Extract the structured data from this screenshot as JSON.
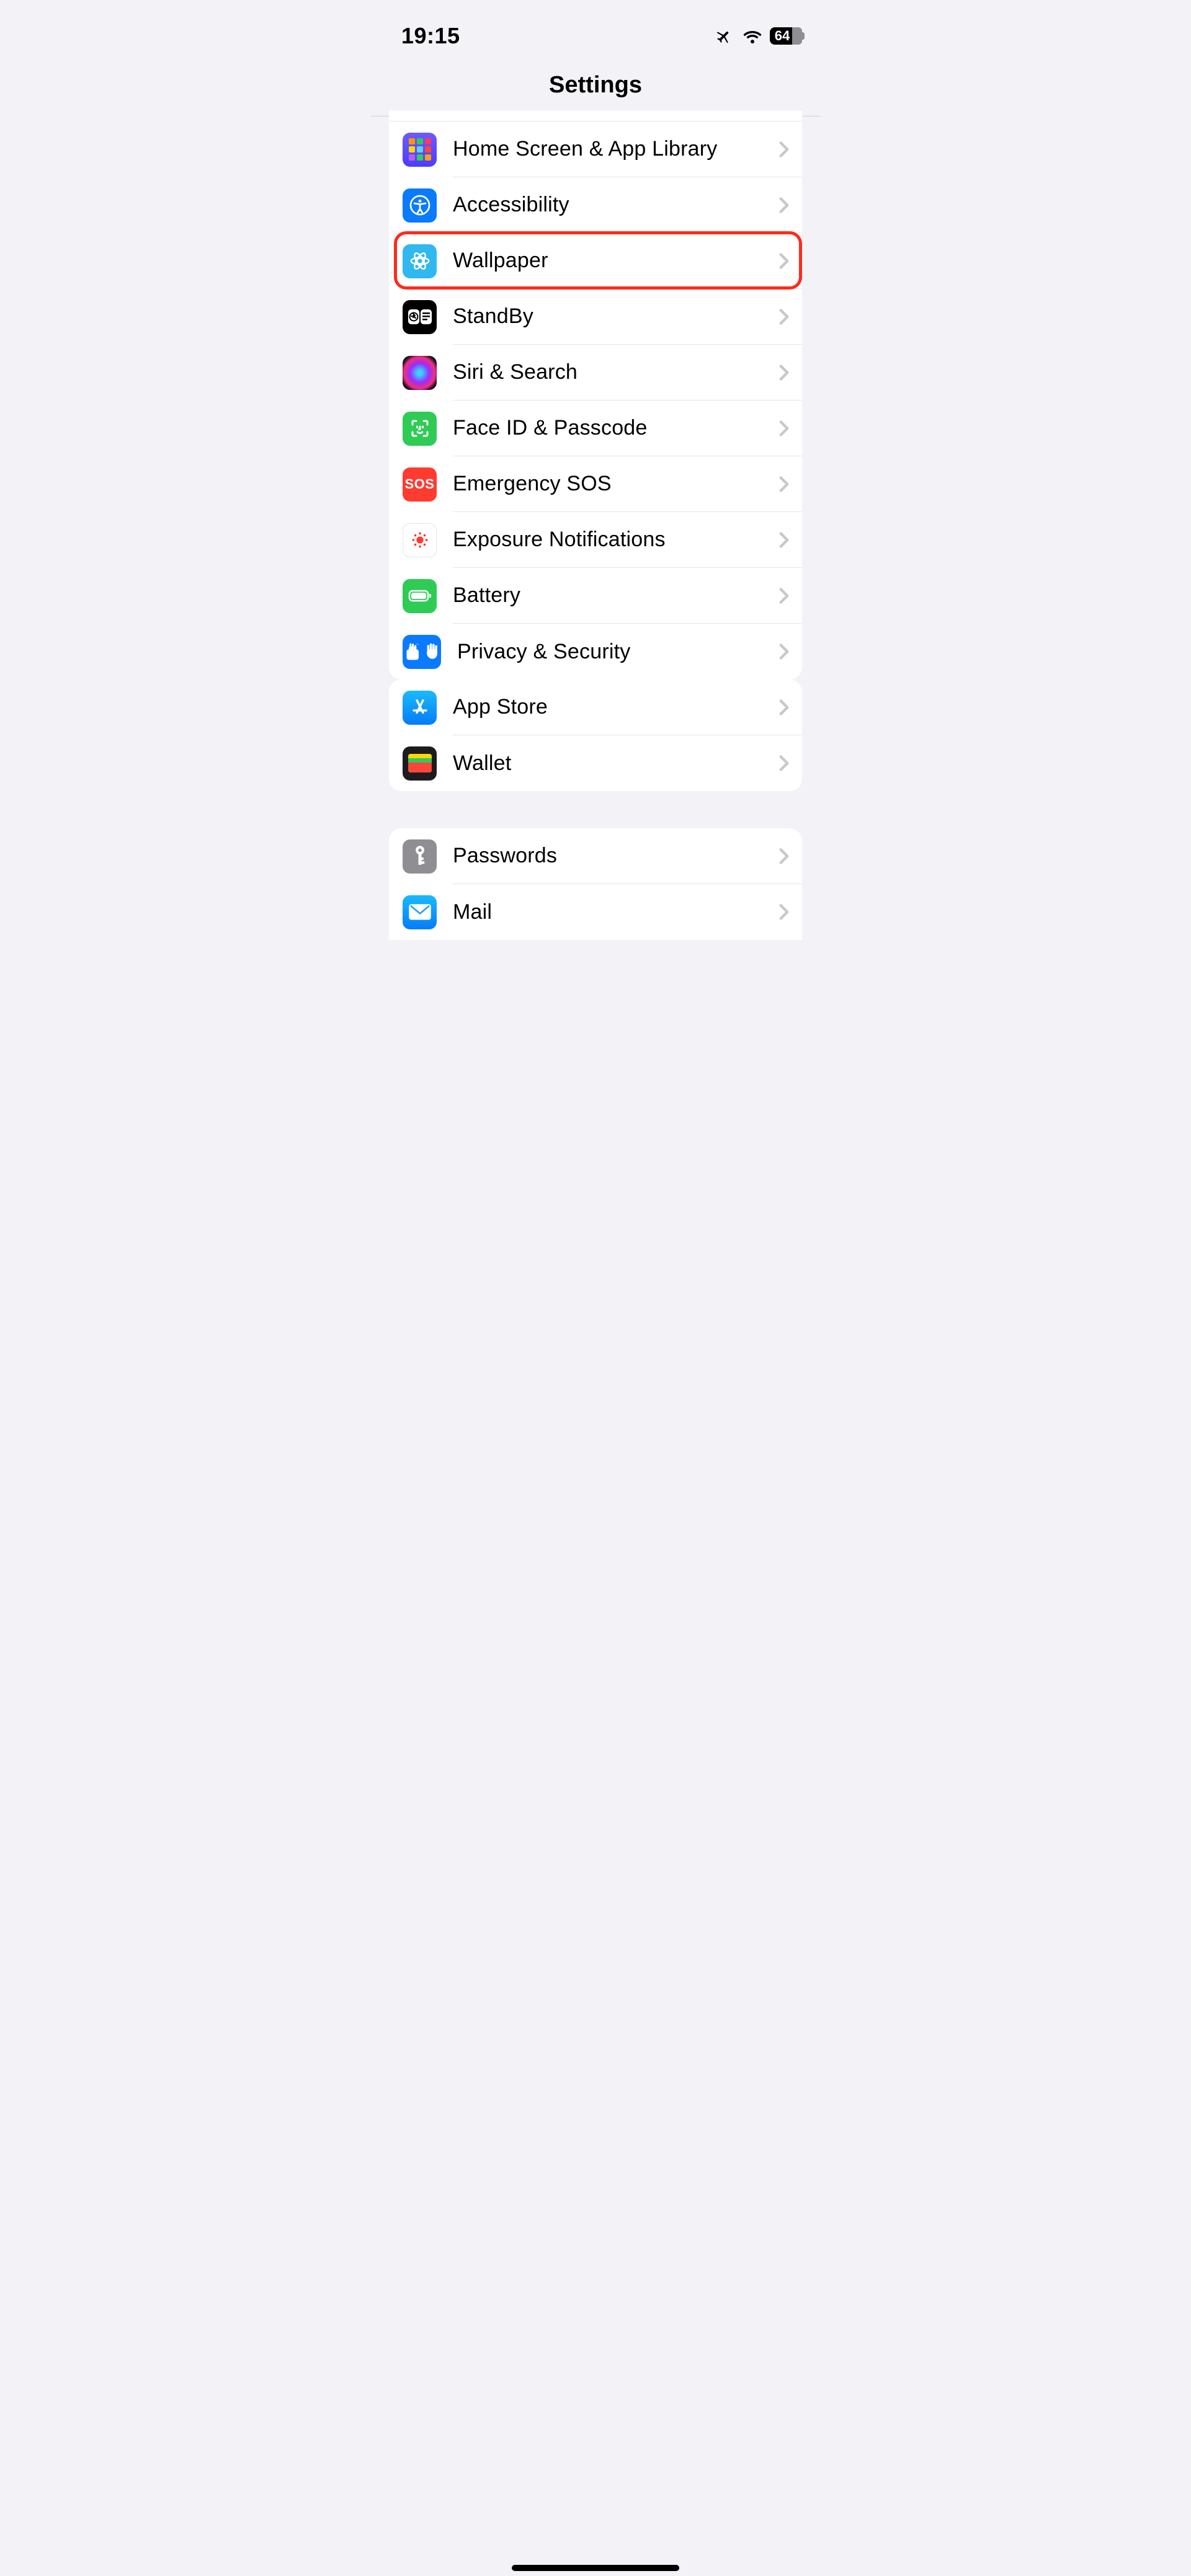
{
  "status": {
    "time": "19:15",
    "battery_percent": "64"
  },
  "header": {
    "title": "Settings"
  },
  "sections": [
    {
      "rows": [
        {
          "label": "Home Screen & App Library"
        },
        {
          "label": "Accessibility"
        },
        {
          "label": "Wallpaper"
        },
        {
          "label": "StandBy"
        },
        {
          "label": "Siri & Search"
        },
        {
          "label": "Face ID & Passcode"
        },
        {
          "label": "Emergency SOS"
        },
        {
          "label": "Exposure Notifications"
        },
        {
          "label": "Battery"
        },
        {
          "label": "Privacy & Security"
        }
      ]
    },
    {
      "rows": [
        {
          "label": "App Store"
        },
        {
          "label": "Wallet"
        }
      ]
    },
    {
      "rows": [
        {
          "label": "Passwords"
        },
        {
          "label": "Mail"
        }
      ]
    }
  ]
}
